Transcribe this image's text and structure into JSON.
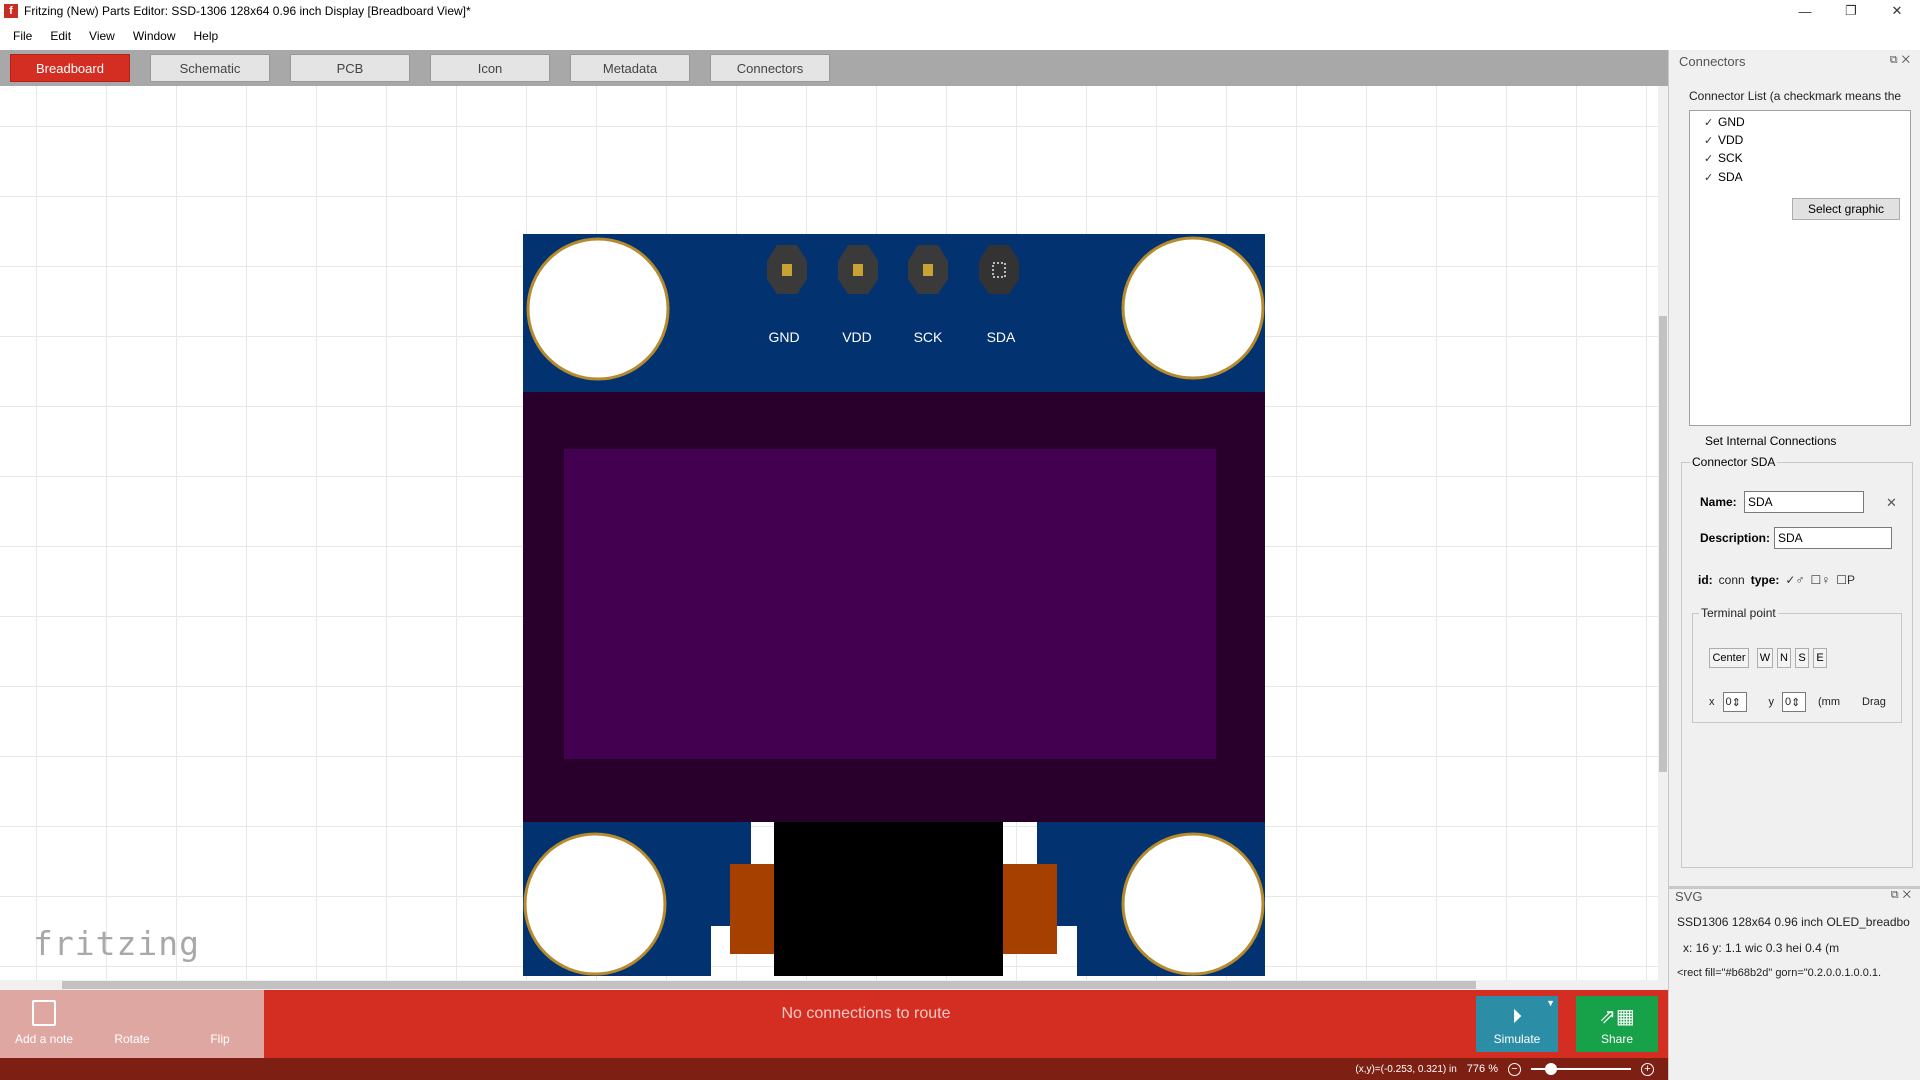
{
  "window": {
    "title": "Fritzing (New) Parts Editor: SSD-1306 128x64 0.96 inch  Display [Breadboard View]*",
    "controls": [
      "—",
      "❐",
      "✕"
    ]
  },
  "menu": [
    "File",
    "Edit",
    "View",
    "Window",
    "Help"
  ],
  "tabs": [
    {
      "label": "Breadboard",
      "active": true
    },
    {
      "label": "Schematic"
    },
    {
      "label": "PCB"
    },
    {
      "label": "Icon"
    },
    {
      "label": "Metadata"
    },
    {
      "label": "Connectors"
    }
  ],
  "canvas": {
    "watermark": "fritzing",
    "board": {
      "pin_labels": [
        "GND",
        "VDD",
        "SCK",
        "SDA"
      ],
      "colors": {
        "pcb": "#033271",
        "frame": "#29002c",
        "screen": "#440050",
        "hole_ring": "#b68b2d",
        "pin_pad": "#3a3a3a",
        "pin_core": "#c8a232",
        "copper": "#a54000",
        "ribbon": "#000000"
      }
    }
  },
  "toolbar": {
    "add_note": "Add a note",
    "rotate": "Rotate",
    "flip": "Flip",
    "status": "No connections to route",
    "simulate": "Simulate",
    "share": "Share",
    "colors": {
      "bar": "#d42e22",
      "simulate": "#2c8ea6",
      "share": "#17a148"
    }
  },
  "statusbar": {
    "coords": "(x,y)=(-0.253, 0.321) in",
    "zoom": "776 %"
  },
  "connectors_panel": {
    "title": "Connectors",
    "list_label": "Connector List (a checkmark means the",
    "items": [
      {
        "name": "GND",
        "checked": true
      },
      {
        "name": "VDD",
        "checked": true
      },
      {
        "name": "SCK",
        "checked": true
      },
      {
        "name": "SDA",
        "checked": true
      }
    ],
    "select_graphic": "Select graphic",
    "internal_connections": "Set Internal Connections",
    "detail_title": "Connector SDA",
    "name_label": "Name:",
    "name_value": "SDA",
    "description_label": "Description:",
    "description_value": "SDA",
    "id_label": "id:",
    "id_value": "conn",
    "type_label": "type:",
    "type_options": [
      "♂",
      "♀",
      "P"
    ],
    "terminal_title": "Terminal point",
    "terminal_buttons": [
      "Center",
      "W",
      "N",
      "S",
      "E"
    ],
    "x_label": "x",
    "x_value": "0",
    "y_label": "y",
    "y_value": "0",
    "unit": "(mm",
    "drag": "Drag"
  },
  "svg_panel": {
    "title": "SVG",
    "file": "SSD1306 128x64 0.96 inch OLED_breadbo",
    "geometry": "x: 16    y: 1.1    wic 0.3    hei 0.4    (m",
    "element": "<rect fill=\"#b68b2d\" gorn=\"0.2.0.0.1.0.0.1."
  }
}
